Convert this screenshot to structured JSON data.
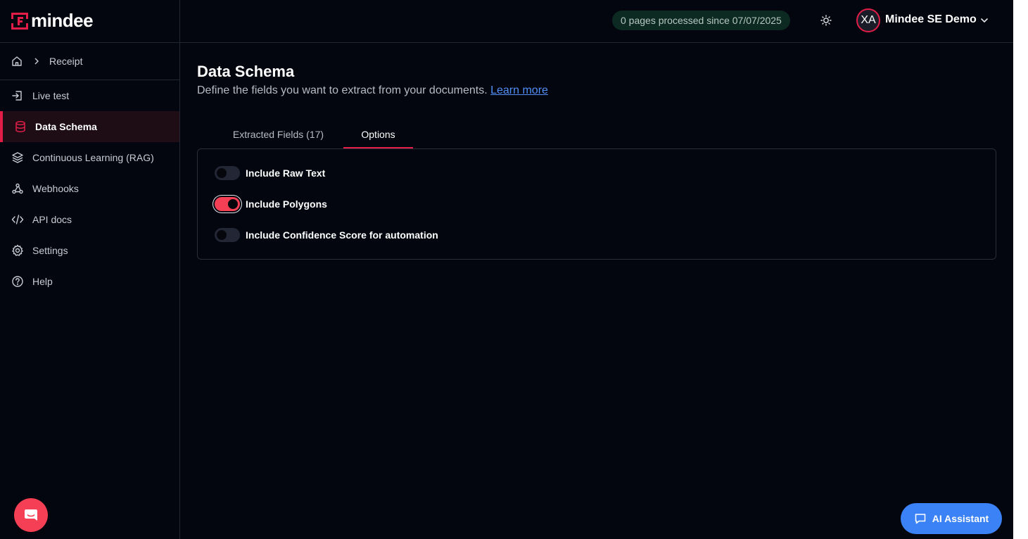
{
  "brand": {
    "name": "mindee",
    "accent": "#e11d48",
    "icon": "mindee-logo-icon"
  },
  "breadcrumb": {
    "home_icon": "home-icon",
    "separator_icon": "chevron-right-icon",
    "current": "Receipt"
  },
  "sidebar": {
    "items": [
      {
        "label": "Live test",
        "icon": "login-icon",
        "active": false
      },
      {
        "label": "Data Schema",
        "icon": "database-icon",
        "active": true
      },
      {
        "label": "Continuous Learning (RAG)",
        "icon": "layers-icon",
        "active": false
      },
      {
        "label": "Webhooks",
        "icon": "webhook-icon",
        "active": false
      },
      {
        "label": "API docs",
        "icon": "code-icon",
        "active": false
      },
      {
        "label": "Settings",
        "icon": "gear-icon",
        "active": false
      },
      {
        "label": "Help",
        "icon": "help-circle-icon",
        "active": false
      }
    ]
  },
  "header": {
    "usage": "0 pages processed since 07/07/2025",
    "theme_icon": "sun-icon",
    "avatar_initials": "XA",
    "account_name": "Mindee SE Demo",
    "account_menu_icon": "chevron-down-icon"
  },
  "main": {
    "title": "Data Schema",
    "subtitle": "Define the fields you want to extract from your documents.",
    "learn_more": "Learn more",
    "tabs": [
      {
        "label": "Extracted Fields (17)",
        "active": false
      },
      {
        "label": "Options",
        "active": true
      }
    ],
    "options": [
      {
        "label": "Include Raw Text",
        "enabled": false
      },
      {
        "label": "Include Polygons",
        "enabled": true
      },
      {
        "label": "Include Confidence Score for automation",
        "enabled": false
      }
    ]
  },
  "assistant": {
    "label": "AI Assistant",
    "icon": "chat-icon"
  },
  "support_chat": {
    "icon": "chat-bubble-icon",
    "color": "#f43f54"
  }
}
